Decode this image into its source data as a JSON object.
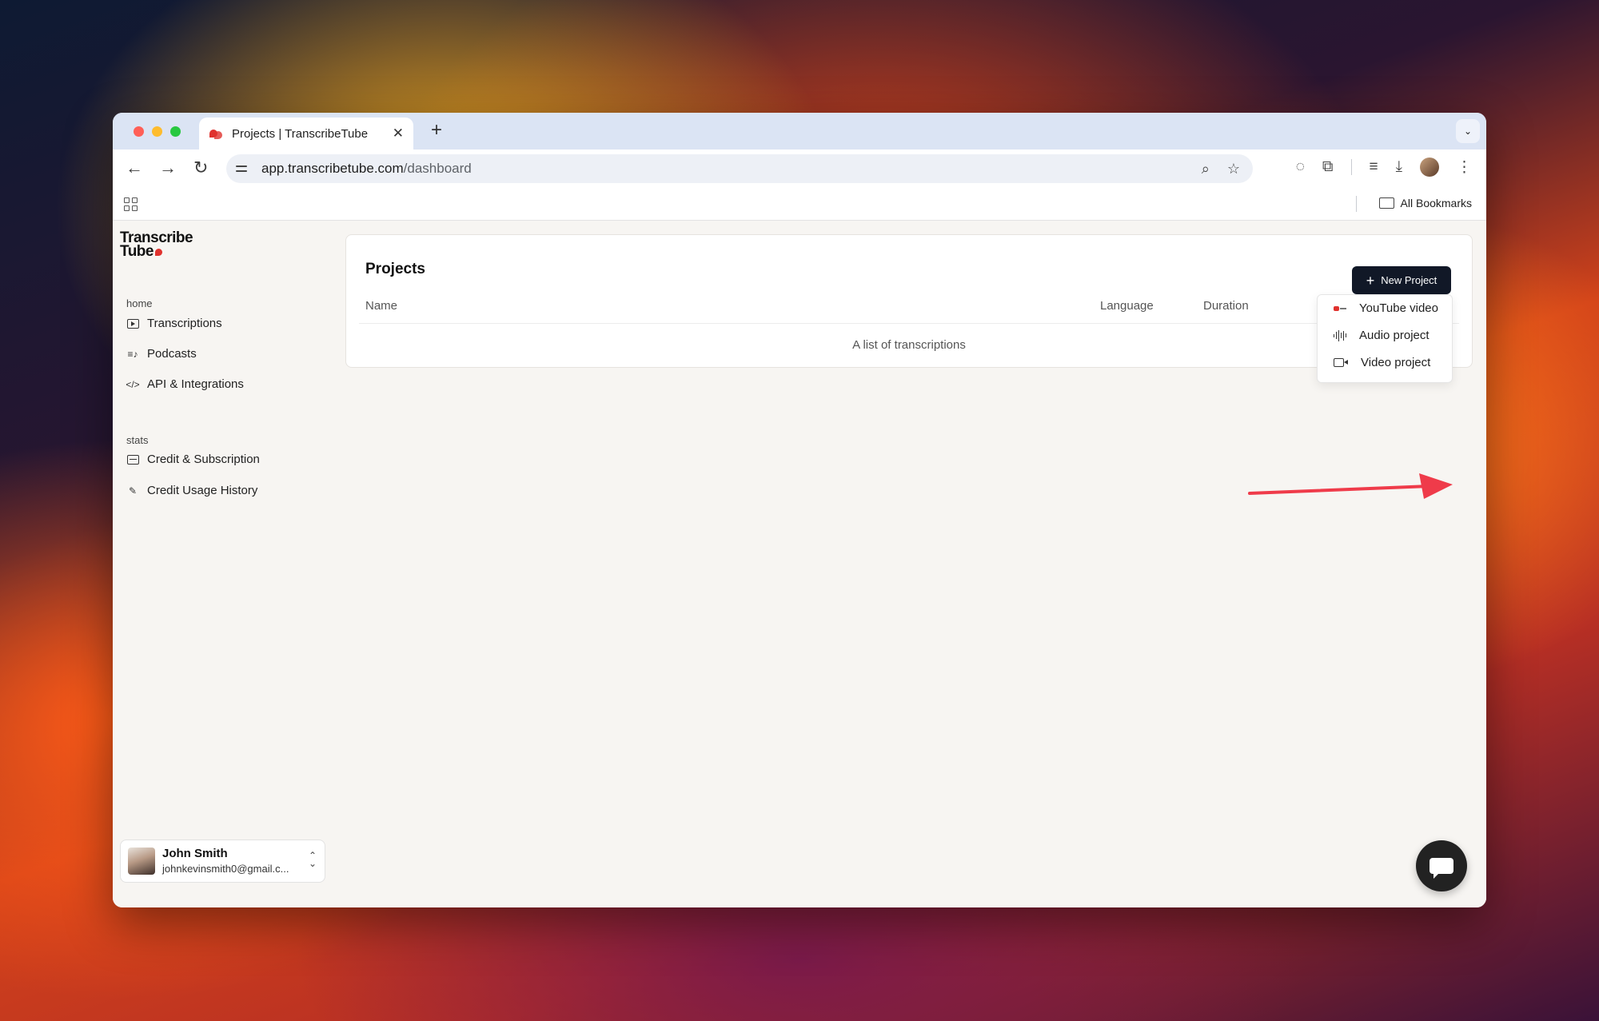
{
  "browser": {
    "tab_title": "Projects | TranscribeTube",
    "tab_close": "✕",
    "new_tab": "+",
    "tab_menu": "⌄",
    "back": "←",
    "forward": "→",
    "reload": "↻",
    "url_host": "app.transcribetube.com",
    "url_path": "/dashboard",
    "zoom_icon": "⌕",
    "star_icon": "☆",
    "bookmarks_label": "All Bookmarks"
  },
  "sidebar": {
    "logo_line1": "Transcribe",
    "logo_line2": "Tube",
    "home_label": "home",
    "home_items": [
      {
        "label": "Transcriptions",
        "icon": "play-box-icon"
      },
      {
        "label": "Podcasts",
        "icon": "playlist-icon"
      },
      {
        "label": "API & Integrations",
        "icon": "code-icon"
      }
    ],
    "stats_label": "stats",
    "stats_items": [
      {
        "label": "Credit & Subscription",
        "icon": "card-icon"
      },
      {
        "label": "Credit Usage History",
        "icon": "edit-icon"
      }
    ],
    "user": {
      "name": "John Smith",
      "email": "johnkevinsmith0@gmail.c..."
    }
  },
  "main": {
    "title": "Projects",
    "columns": [
      "Name",
      "Language",
      "Duration"
    ],
    "empty_text": "A list of transcriptions",
    "new_project_label": "New Project",
    "dropdown": [
      {
        "label": "YouTube video",
        "icon": "youtube-icon"
      },
      {
        "label": "Audio project",
        "icon": "audio-wave-icon"
      },
      {
        "label": "Video project",
        "icon": "video-camera-icon"
      }
    ]
  },
  "colors": {
    "accent_dark": "#111827",
    "brand_red": "#e0322e",
    "annotation_arrow": "#ef3b4a"
  }
}
